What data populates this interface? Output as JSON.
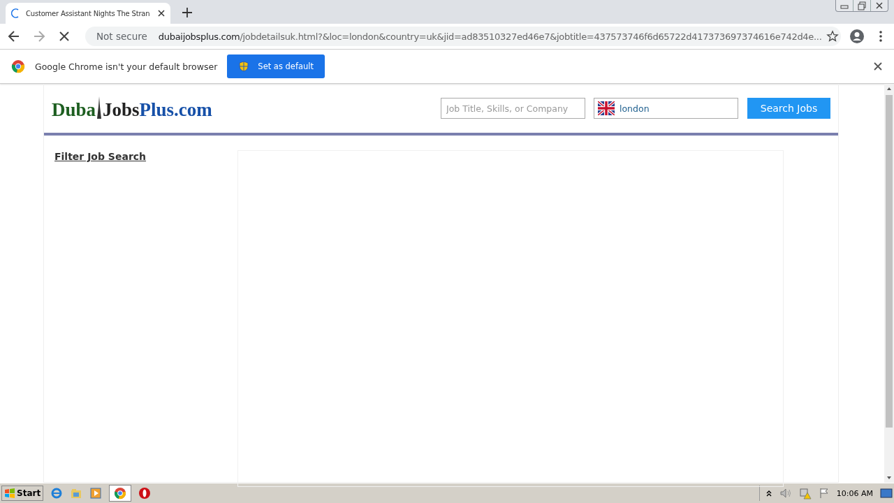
{
  "browser": {
    "tabs": [
      {
        "title": "Customer Assistant Nights The Stran",
        "selected": true
      }
    ],
    "address": {
      "security": "Not secure",
      "domain": "dubaijobsplus.com",
      "path": "/jobdetailsuk.html?&loc=london&country=uk&jid=ad83510327ed46e7&jobtitle=437573746f6d65722d417373697374616e742d4e..."
    },
    "infobar": {
      "message": "Google Chrome isn't your default browser",
      "button": "Set as default"
    }
  },
  "site": {
    "logo": [
      "Duba",
      "Jobs",
      "Plus.com"
    ],
    "search": {
      "placeholder": "Job Title, Skills, or Company"
    },
    "location": {
      "value": "london"
    },
    "search_button": "Search Jobs",
    "filter_heading": "Filter Job Search"
  },
  "taskbar": {
    "start": "Start",
    "clock": "10:06 AM"
  }
}
